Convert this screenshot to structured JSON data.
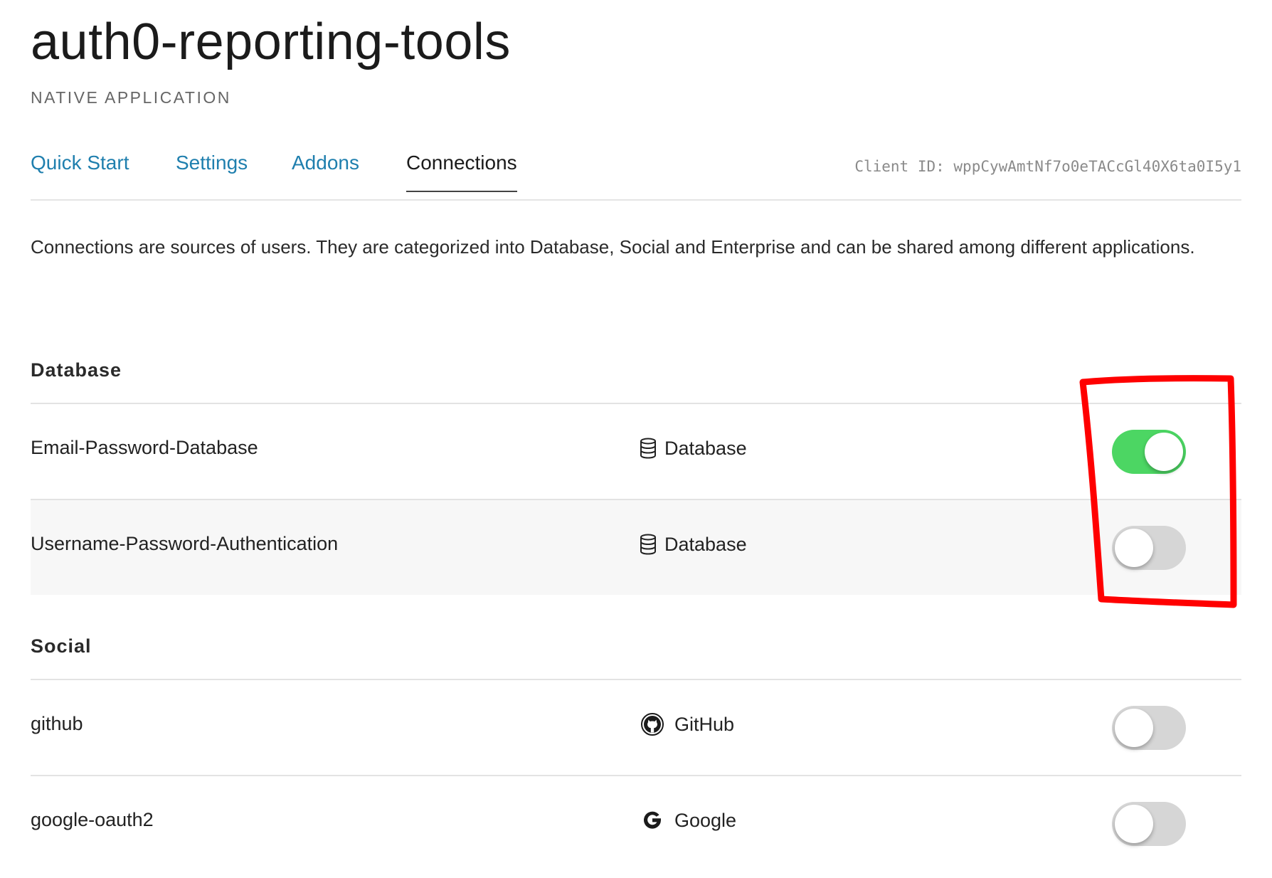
{
  "header": {
    "title": "auth0-reporting-tools",
    "subtitle": "NATIVE APPLICATION"
  },
  "tabs": [
    {
      "label": "Quick Start",
      "active": false
    },
    {
      "label": "Settings",
      "active": false
    },
    {
      "label": "Addons",
      "active": false
    },
    {
      "label": "Connections",
      "active": true
    }
  ],
  "client_id": "Client ID: wppCywAmtNf7o0eTACcGl40X6ta0I5y1",
  "description": "Connections are sources of users. They are categorized into Database, Social and Enterprise and can be shared among different applications.",
  "sections": [
    {
      "title": "Database",
      "connections": [
        {
          "name": "Email-Password-Database",
          "type_label": "Database",
          "type_icon": "database-icon",
          "enabled": true
        },
        {
          "name": "Username-Password-Authentication",
          "type_label": "Database",
          "type_icon": "database-icon",
          "enabled": false
        }
      ]
    },
    {
      "title": "Social",
      "connections": [
        {
          "name": "github",
          "type_label": "GitHub",
          "type_icon": "github-icon",
          "enabled": false
        },
        {
          "name": "google-oauth2",
          "type_label": "Google",
          "type_icon": "google-icon",
          "enabled": false
        }
      ]
    }
  ],
  "colors": {
    "link": "#1f7fae",
    "toggle_on": "#4cd663",
    "toggle_off": "#d6d6d6",
    "highlight": "#ff0000"
  }
}
